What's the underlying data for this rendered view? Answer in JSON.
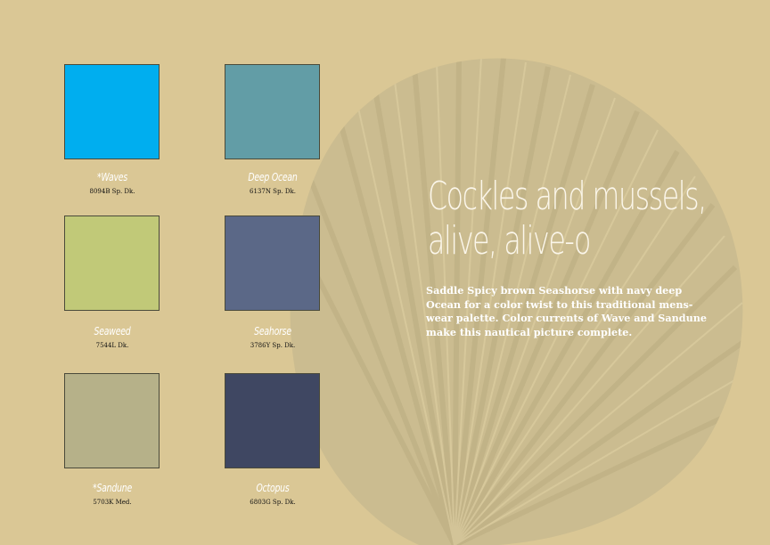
{
  "headline": {
    "line1": "Cockles and mussels,",
    "line2": "alive, alive-o"
  },
  "body": "Saddle Spicy brown Seashorse with navy deep Ocean for a color twist to this traditional mens-wear palette. Color currents of Wave and Sandune make this nautical picture complete.",
  "swatches": [
    {
      "name": "*Waves",
      "code": "8094B Sp. Dk.",
      "color": "#00aeef"
    },
    {
      "name": "Deep Ocean",
      "code": "6137N Sp. Dk.",
      "color": "#629da6"
    },
    {
      "name": "Seaweed",
      "code": "7544L Dk.",
      "color": "#c1c978"
    },
    {
      "name": "Seahorse",
      "code": "3786Y Sp. Dk.",
      "color": "#5b6887"
    },
    {
      "name": "*Sandune",
      "code": "5703K Med.",
      "color": "#b6b189"
    },
    {
      "name": "Octopus",
      "code": "6803G Sp. Dk.",
      "color": "#3f4762"
    }
  ],
  "colors": {
    "background": "#dac795",
    "shell": "#c3b68a"
  }
}
